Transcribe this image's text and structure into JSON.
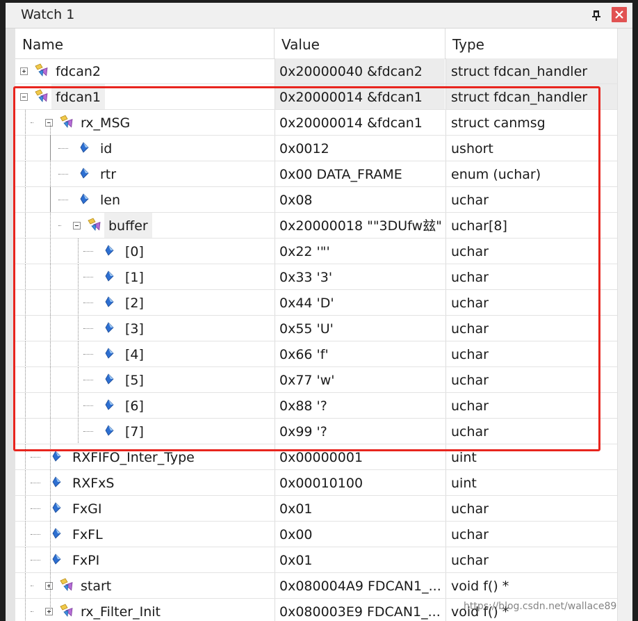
{
  "window": {
    "title": "Watch 1"
  },
  "columns": {
    "name": "Name",
    "value": "Value",
    "type": "Type"
  },
  "rows": [
    {
      "name": "fdcan2",
      "value": "0x20000040 &fdcan2",
      "type": "struct fdcan_handler",
      "level": 0,
      "expander": "plus",
      "icon": "struct-icon"
    },
    {
      "name": "fdcan1",
      "value": "0x20000014 &fdcan1",
      "type": "struct fdcan_handler",
      "level": 0,
      "expander": "minus",
      "icon": "struct-icon"
    },
    {
      "name": "rx_MSG",
      "value": "0x20000014 &fdcan1",
      "type": "struct canmsg",
      "level": 1,
      "expander": "minus",
      "icon": "struct-icon"
    },
    {
      "name": "id",
      "value": "0x0012",
      "type": "ushort",
      "level": 2,
      "expander": "",
      "icon": "variable-icon"
    },
    {
      "name": "rtr",
      "value": "0x00 DATA_FRAME",
      "type": "enum (uchar)",
      "level": 2,
      "expander": "",
      "icon": "variable-icon"
    },
    {
      "name": "len",
      "value": "0x08",
      "type": "uchar",
      "level": 2,
      "expander": "",
      "icon": "variable-icon"
    },
    {
      "name": "buffer",
      "value": "0x20000018 \"\"3DUfw玆\"",
      "type": "uchar[8]",
      "level": 2,
      "expander": "minus",
      "icon": "struct-icon"
    },
    {
      "name": "[0]",
      "value": "0x22 '\"'",
      "type": "uchar",
      "level": 3,
      "expander": "",
      "icon": "variable-icon"
    },
    {
      "name": "[1]",
      "value": "0x33 '3'",
      "type": "uchar",
      "level": 3,
      "expander": "",
      "icon": "variable-icon"
    },
    {
      "name": "[2]",
      "value": "0x44 'D'",
      "type": "uchar",
      "level": 3,
      "expander": "",
      "icon": "variable-icon"
    },
    {
      "name": "[3]",
      "value": "0x55 'U'",
      "type": "uchar",
      "level": 3,
      "expander": "",
      "icon": "variable-icon"
    },
    {
      "name": "[4]",
      "value": "0x66 'f'",
      "type": "uchar",
      "level": 3,
      "expander": "",
      "icon": "variable-icon"
    },
    {
      "name": "[5]",
      "value": "0x77 'w'",
      "type": "uchar",
      "level": 3,
      "expander": "",
      "icon": "variable-icon"
    },
    {
      "name": "[6]",
      "value": "0x88 '?",
      "type": "uchar",
      "level": 3,
      "expander": "",
      "icon": "variable-icon"
    },
    {
      "name": "[7]",
      "value": "0x99 '?",
      "type": "uchar",
      "level": 3,
      "expander": "",
      "icon": "variable-icon"
    },
    {
      "name": "RXFIFO_Inter_Type",
      "value": "0x00000001",
      "type": "uint",
      "level": 1,
      "expander": "",
      "icon": "variable-icon"
    },
    {
      "name": "RXFxS",
      "value": "0x00010100",
      "type": "uint",
      "level": 1,
      "expander": "",
      "icon": "variable-icon"
    },
    {
      "name": "FxGI",
      "value": "0x01",
      "type": "uchar",
      "level": 1,
      "expander": "",
      "icon": "variable-icon"
    },
    {
      "name": "FxFL",
      "value": "0x00",
      "type": "uchar",
      "level": 1,
      "expander": "",
      "icon": "variable-icon"
    },
    {
      "name": "FxPI",
      "value": "0x01",
      "type": "uchar",
      "level": 1,
      "expander": "",
      "icon": "variable-icon"
    },
    {
      "name": "start",
      "value": "0x080004A9 FDCAN1_...",
      "type": "void f()  *",
      "level": 1,
      "expander": "plus",
      "icon": "struct-icon"
    },
    {
      "name": "rx_Filter_Init",
      "value": "0x080003E9 FDCAN1_...",
      "type": "void f()  *",
      "level": 1,
      "expander": "plus",
      "icon": "struct-icon"
    }
  ],
  "watermark": "https://blog.csdn.net/wallace89",
  "colors": {
    "highlight": "#e8251e",
    "close_button": "#e15252",
    "variable_icon": "#2d6fd1"
  }
}
